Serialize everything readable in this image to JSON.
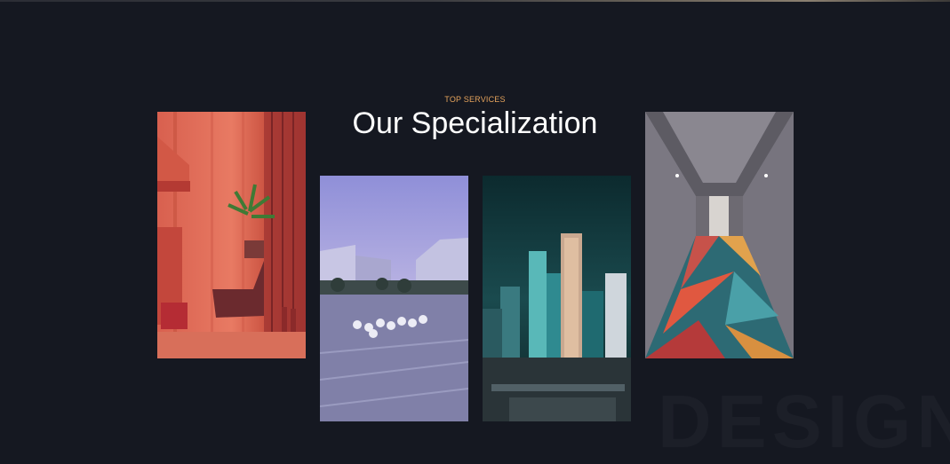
{
  "section": {
    "eyebrow": "TOP SERVICES",
    "title": "Our Specialization",
    "watermark": "DESIGN"
  },
  "colors": {
    "background": "#151821",
    "eyebrow": "#e5a35c",
    "title": "#ffffff"
  },
  "cards": [
    {
      "image": "red-interior-lounge-image"
    },
    {
      "image": "modern-plaza-architecture-image"
    },
    {
      "image": "night-city-skyline-image"
    },
    {
      "image": "hotel-corridor-geometric-carpet-image"
    }
  ]
}
